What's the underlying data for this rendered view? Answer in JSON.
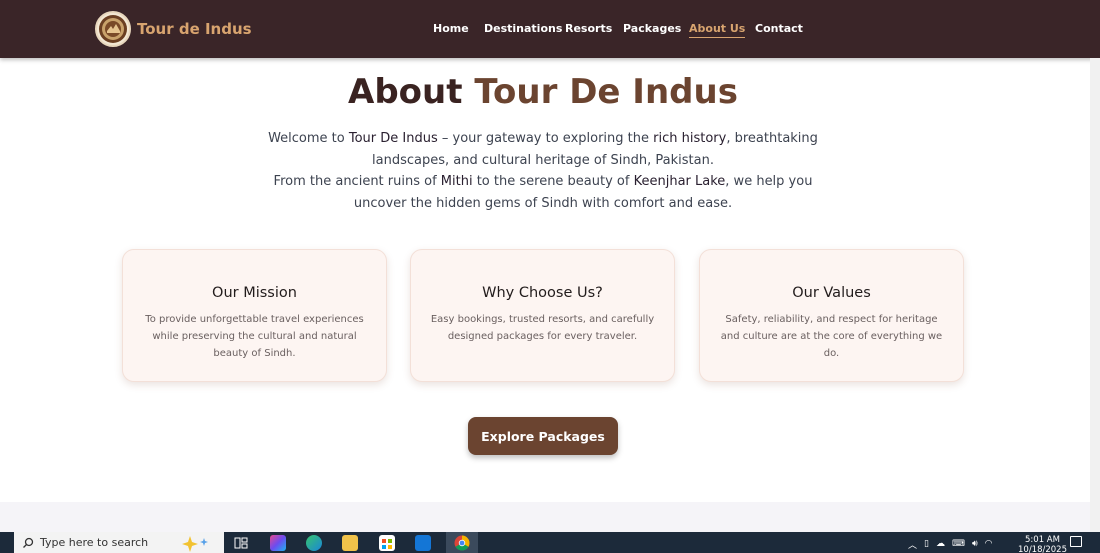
{
  "nav": {
    "brand": "Tour de Indus",
    "links": [
      "Home",
      "Destinations",
      "Resorts",
      "Packages",
      "About Us",
      "Contact"
    ],
    "active": "About Us"
  },
  "hero": {
    "title_prefix": "About",
    "title_accent": "Tour De Indus",
    "intro": {
      "p1_a": "Welcome to ",
      "p1_b": "Tour De Indus",
      "p1_c": " – your gateway to exploring the ",
      "p1_d": "rich history",
      "p1_e": ", breathtaking landscapes, and cultural heritage of Sindh, Pakistan.",
      "p2_a": "From the ancient ruins of ",
      "p2_b": "Mithi",
      "p2_c": " to the serene beauty of ",
      "p2_d": "Keenjhar Lake",
      "p2_e": ", we help you uncover the hidden gems of Sindh with comfort and ease."
    }
  },
  "cards": [
    {
      "title": "Our Mission",
      "text": "To provide unforgettable travel experiences while preserving the cultural and natural beauty of Sindh."
    },
    {
      "title": "Why Choose Us?",
      "text": "Easy bookings, trusted resorts, and carefully designed packages for every traveler."
    },
    {
      "title": "Our Values",
      "text": "Safety, reliability, and respect for heritage and culture are at the core of everything we do."
    }
  ],
  "cta": {
    "label": "Explore Packages"
  },
  "taskbar": {
    "search_placeholder": "Type here to search",
    "time": "5:01 AM",
    "date": "10/18/2025"
  },
  "colors": {
    "nav_bg": "#3a2528",
    "brand_accent": "#d8a46f",
    "title_dark": "#3a2321",
    "title_accent": "#6b4430",
    "card_bg": "#fdf5f2",
    "button_bg": "#6b4430"
  }
}
